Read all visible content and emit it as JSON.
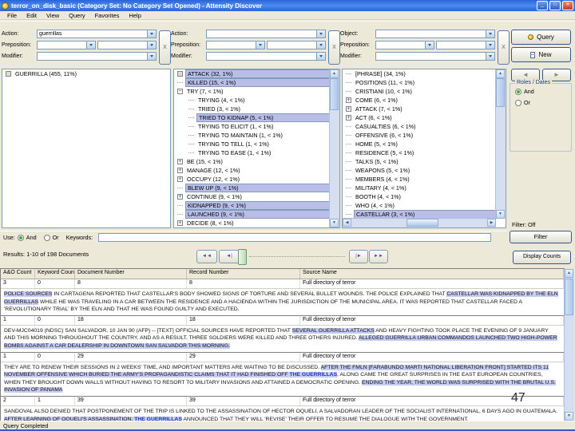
{
  "window": {
    "title": "terror_on_disk_basic (Category Set: No Category Set Opened) - Attensity Discover",
    "menu": [
      "File",
      "Edit",
      "View",
      "Query",
      "Favorites",
      "Help"
    ],
    "minimize_label": "_",
    "restore_label": "□",
    "close_label": "✕"
  },
  "query_builder": {
    "groups": [
      {
        "row1_label": "Action:",
        "row1_value": "guerrillas",
        "row2_label": "Preposition:",
        "row3_label": "Modifier:",
        "remove_label": "X"
      },
      {
        "row1_label": "Action:",
        "row1_value": "",
        "row2_label": "Preposition:",
        "row3_label": "Modifier:",
        "remove_label": "X"
      },
      {
        "row1_label": "Object:",
        "row1_value": "",
        "row2_label": "Preposition:",
        "row3_label": "Modifier:",
        "remove_label": "X"
      }
    ],
    "query_button": "Query",
    "new_button": "New"
  },
  "panels": {
    "left": {
      "items": [
        {
          "icon": "box",
          "label": "GUERRILLA (455, 11%)",
          "child": false,
          "sel": false
        }
      ]
    },
    "middle": {
      "items": [
        {
          "icon": "box",
          "label": "ATTACK (32, 1%)",
          "child": false,
          "sel": true
        },
        {
          "icon": "leaf",
          "label": "KILLED (15, < 1%)",
          "child": false,
          "sel": true
        },
        {
          "icon": "minus",
          "label": "TRY (7, < 1%)",
          "child": false,
          "sel": false
        },
        {
          "icon": "leaf",
          "label": "TRYING (4, < 1%)",
          "child": true,
          "sel": false
        },
        {
          "icon": "leaf",
          "label": "TRIED (3, < 1%)",
          "child": true,
          "sel": false
        },
        {
          "icon": "leaf",
          "label": "TRIED TO KIDNAP (5, < 1%)",
          "child": true,
          "sel": true
        },
        {
          "icon": "leaf",
          "label": "TRYING TO ELICIT (1, < 1%)",
          "child": true,
          "sel": false
        },
        {
          "icon": "leaf",
          "label": "TRYING TO MAINTAIN (1, < 1%)",
          "child": true,
          "sel": false
        },
        {
          "icon": "leaf",
          "label": "TRYING TO TELL (1, < 1%)",
          "child": true,
          "sel": false
        },
        {
          "icon": "leaf",
          "label": "TRYING TO EASE (1, < 1%)",
          "child": true,
          "sel": false
        },
        {
          "icon": "plus",
          "label": "BE (15, < 1%)",
          "child": false,
          "sel": false
        },
        {
          "icon": "plus",
          "label": "MANAGE (12, < 1%)",
          "child": false,
          "sel": false
        },
        {
          "icon": "plus",
          "label": "OCCUPY (12, < 1%)",
          "child": false,
          "sel": false
        },
        {
          "icon": "leaf",
          "label": "BLEW UP (9, < 1%)",
          "child": false,
          "sel": true
        },
        {
          "icon": "plus",
          "label": "CONTINUE (9, < 1%)",
          "child": false,
          "sel": false
        },
        {
          "icon": "leaf",
          "label": "KIDNAPPED (9, < 1%)",
          "child": false,
          "sel": true
        },
        {
          "icon": "leaf",
          "label": "LAUNCHED (9, < 1%)",
          "child": false,
          "sel": true
        },
        {
          "icon": "plus",
          "label": "DECIDE (8, < 1%)",
          "child": false,
          "sel": false
        }
      ]
    },
    "right": {
      "items": [
        {
          "icon": "leaf",
          "label": "[PHRASE] (34, 1%)",
          "child": false,
          "sel": false
        },
        {
          "icon": "leaf",
          "label": "POSITIONS (11, < 1%)",
          "child": false,
          "sel": false
        },
        {
          "icon": "leaf",
          "label": "CRISTIANI (10, < 1%)",
          "child": false,
          "sel": false
        },
        {
          "icon": "plus",
          "label": "COME (6, < 1%)",
          "child": false,
          "sel": false
        },
        {
          "icon": "plus",
          "label": "ATTACK (7, < 1%)",
          "child": false,
          "sel": false
        },
        {
          "icon": "plus",
          "label": "ACT (6, < 1%)",
          "child": false,
          "sel": false
        },
        {
          "icon": "leaf",
          "label": "CASUALTIES (6, < 1%)",
          "child": false,
          "sel": false
        },
        {
          "icon": "leaf",
          "label": "OFFENSIVE (6, < 1%)",
          "child": false,
          "sel": false
        },
        {
          "icon": "leaf",
          "label": "HOME (5, < 1%)",
          "child": false,
          "sel": false
        },
        {
          "icon": "leaf",
          "label": "RESIDENCE (5, < 1%)",
          "child": false,
          "sel": false
        },
        {
          "icon": "leaf",
          "label": "TALKS (5, < 1%)",
          "child": false,
          "sel": false
        },
        {
          "icon": "leaf",
          "label": "WEAPONS (5, < 1%)",
          "child": false,
          "sel": false
        },
        {
          "icon": "leaf",
          "label": "MEMBERS (4, < 1%)",
          "child": false,
          "sel": false
        },
        {
          "icon": "leaf",
          "label": "MILITARY (4, < 1%)",
          "child": false,
          "sel": false
        },
        {
          "icon": "leaf",
          "label": "BOOTH (4, < 1%)",
          "child": false,
          "sel": false
        },
        {
          "icon": "leaf",
          "label": "WHO (4, < 1%)",
          "child": false,
          "sel": false
        },
        {
          "icon": "leaf",
          "label": "CASTELLAR (3, < 1%)",
          "child": false,
          "sel": true
        }
      ]
    }
  },
  "side": {
    "back_icon": "◄",
    "forward_icon": "►",
    "roles_group": {
      "title": "Roles / Dates",
      "and_label": "And",
      "or_label": "Or",
      "selected": "And"
    },
    "filter_status": "Filter: Off",
    "filter_button": "Filter"
  },
  "keywords_bar": {
    "use_label": "Use:",
    "and_label": "And",
    "or_label": "Or",
    "keywords_label": "Keywords:",
    "value": ""
  },
  "results_bar": {
    "text": "Results: 1-10 of 198 Documents",
    "nav": [
      {
        "name": "first-page",
        "glyph": "◄◄"
      },
      {
        "name": "previous-page",
        "glyph": "◄|"
      },
      {
        "name": "next-page",
        "glyph": "|►"
      },
      {
        "name": "last-page",
        "glyph": "►►"
      }
    ],
    "display_counts_button": "Display Counts"
  },
  "table": {
    "headers": [
      "A&O Count",
      "Keyword Count",
      "Document Number",
      "Record Number",
      "Source Name"
    ],
    "rows": [
      {
        "cells": [
          "3",
          "0",
          "8",
          "8",
          "Full directory of terror"
        ],
        "segments": [
          {
            "t": "POLICE SOURCES",
            "h": 1
          },
          {
            "t": " IN CARTAGENA REPORTED THAT CASTELLAR'S BODY SHOWED SIGNS OF TORTURE AND SEVERAL BULLET WOUNDS. THE POLICE EXPLAINED THAT ",
            "h": 0
          },
          {
            "t": "CASTELLAR WAS KIDNAPPED BY THE ELN GUERRILLAS",
            "h": 1
          },
          {
            "t": " WHILE HE WAS TRAVELING IN A CAR BETWEEN THE RESIDENCE AND A HACIENDA WITHIN THE JURISDICTION OF THE MUNICIPAL AREA. IT WAS REPORTED THAT CASTELLAR FACED A 'REVOLUTIONARY TRIAL' BY THE ELN AND THAT HE WAS FOUND GUILTY AND EXECUTED.",
            "h": 0
          }
        ]
      },
      {
        "cells": [
          "1",
          "0",
          "18",
          "18",
          "Full directory of terror"
        ],
        "segments": [
          {
            "t": "DEV-MJC04019 (NDSC) SAN SALVADOR, 10 JAN 90 (AFP) -- [TEXT] OFFICIAL SOURCES HAVE REPORTED THAT ",
            "h": 0
          },
          {
            "t": "SEVERAL GUERRILLA ATTACKS",
            "h": 1
          },
          {
            "t": " AND HEAVY FIGHTING TOOK PLACE THE EVENING OF 9 JANUARY AND THIS MORNING THROUGHOUT THE COUNTRY, AND AS A RESULT, THREE SOLDIERS WERE KILLED AND THREE OTHERS INJURED. ",
            "h": 0
          },
          {
            "t": "ALLEGED GUERRILLA URBAN COMMANDOS LAUNCHED TWO HIGH-POWER BOMBS AGAINST A CAR DEALERSHIP IN DOWNTOWN SAN SALVADOR THIS MORNING.",
            "h": 1
          }
        ]
      },
      {
        "cells": [
          "1",
          "0",
          "29",
          "29",
          "Full directory of terror"
        ],
        "segments": [
          {
            "t": "THEY ARE TO RENEW THEIR SESSIONS IN 2 WEEKS' TIME, AND IMPORTANT MATTERS ARE WAITING TO BE DISCUSSED. ",
            "h": 0
          },
          {
            "t": "AFTER THE FMLN [FARABUNDO MARTI NATIONAL LIBERATION FRONT] STARTED ITS 11 NOVEMBER OFFENSIVE WHICH BURIED THE ARMY'S PROPAGANDISTIC CLAIMS THAT IT HAD FINISHED OFF ",
            "h": 1
          },
          {
            "t": "THE GUERRILLAS",
            "h": 2
          },
          {
            "t": ", ALONG CAME THE GREAT SURPRISES IN THE EAST EUROPEAN COUNTRIES, WHEN THEY BROUGHT DOWN WALLS WITHOUT HAVING TO RESORT TO MILITARY INVASIONS AND ATTAINED A DEMOCRATIC OPENING. ",
            "h": 0
          },
          {
            "t": "ENDING THE YEAR, THE WORLD WAS SURPRISED WITH THE BRUTAL U.S. INVASION OF PANAMA",
            "h": 1
          }
        ]
      },
      {
        "cells": [
          "2",
          "1",
          "39",
          "39",
          "Full directory of terror"
        ],
        "segments": [
          {
            "t": "SANDOVAL ALSO DENIED THAT POSTPONEMENT OF THE TRIP IS LINKED TO THE ASSASSINATION OF HECTOR OQUELI, A SALVADORAN LEADER OF THE SOCIALIST INTERNATIONAL, 6 DAYS AGO IN GUATEMALA. ",
            "h": 0
          },
          {
            "t": "AFTER LEARNING OF OQUELI'S ASSASSINATION, ",
            "h": 1
          },
          {
            "t": "THE GUERRILLAS",
            "h": 2
          },
          {
            "t": " ANNOUNCED THAT THEY WILL 'REVISE' THEIR OFFER TO RESUME THE DIALOGUE WITH THE GOVERNMENT.",
            "h": 0
          }
        ]
      }
    ]
  },
  "status_bar": {
    "text": "Query Completed"
  },
  "slide_number": "47",
  "colors": {
    "titlebar_blue": "#2a63d8",
    "app_background": "#ece9d8",
    "selection_highlight": "#b9bee9",
    "snippet_highlight": "#c6ccf2",
    "keyword_blue": "#1f35c4",
    "bottom_rule_blue": "#3a57c8"
  }
}
